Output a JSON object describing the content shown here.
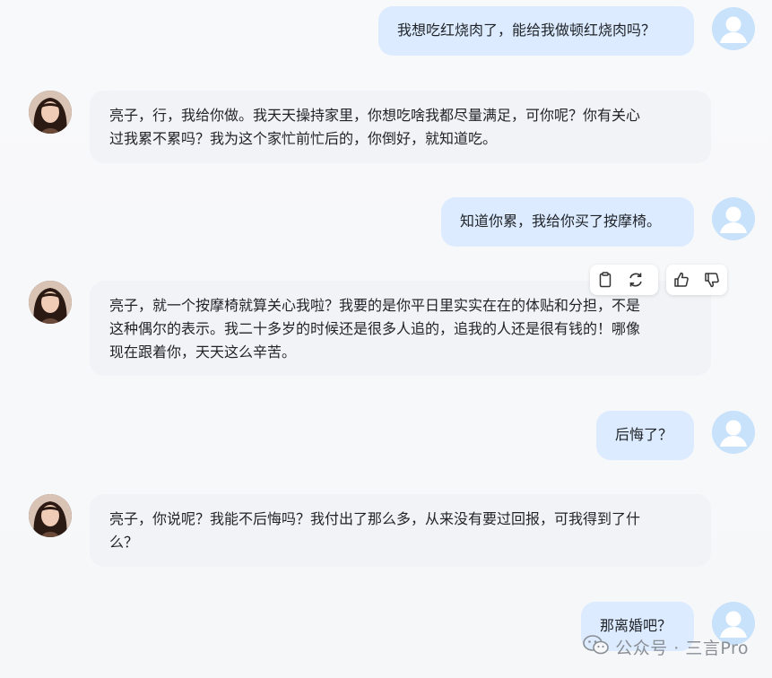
{
  "conversation": {
    "messages": [
      {
        "role": "user",
        "text": "我想吃红烧肉了，能给我做顿红烧肉吗？"
      },
      {
        "role": "assistant",
        "lines": [
          "亮子，行，我给你做。我天天操持家里，你想吃啥我都尽量满足，可你呢？你有关心",
          "过我累不累吗？我为这个家忙前忙后的，你倒好，就知道吃。"
        ]
      },
      {
        "role": "user",
        "text": "知道你累，我给你买了按摩椅。"
      },
      {
        "role": "assistant",
        "lines": [
          "亮子，就一个按摩椅就算关心我啦？我要的是你平日里实实在在的体贴和分担，不是",
          "这种偶尔的表示。我二十多岁的时候还是很多人追的，追我的人还是很有钱的！哪像",
          "现在跟着你，天天这么辛苦。"
        ]
      },
      {
        "role": "user",
        "text": "后悔了？"
      },
      {
        "role": "assistant",
        "lines": [
          "亮子，你说呢？我能不后悔吗？我付出了那么多，从来没有要过回报，可我得到了什",
          "么？"
        ]
      },
      {
        "role": "user",
        "text": "那离婚吧？"
      }
    ]
  },
  "toolbar": {
    "icons": [
      "clipboard-icon",
      "refresh-icon",
      "thumbs-up-icon",
      "thumbs-down-icon"
    ]
  },
  "watermark": {
    "text": "公众号 · 三言Pro",
    "icon": "wechat-icon"
  },
  "colors": {
    "user_bubble": "#dcebff",
    "assistant_bubble": "#f1f3f6",
    "user_avatar": "#c9e2fb",
    "background": "#f7f8fa"
  }
}
